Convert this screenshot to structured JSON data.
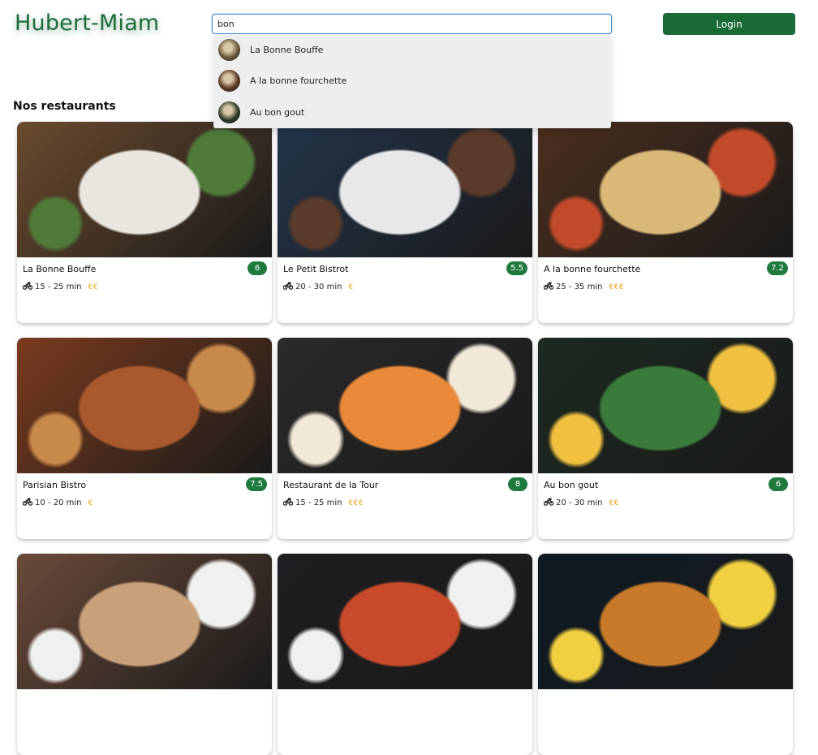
{
  "header": {
    "logo": "Hubert-Miam",
    "search_value": "bon",
    "login_label": "Login"
  },
  "flags": [
    "fr-flag-icon",
    "mx-flag-icon",
    "jp-flag-icon",
    "it-flag-icon"
  ],
  "search_results": [
    {
      "label": "La Bonne Bouffe",
      "thumb_color": "#6b5a3e"
    },
    {
      "label": "A la bonne fourchette",
      "thumb_color": "#5a3b26"
    },
    {
      "label": "Au bon gout",
      "thumb_color": "#2f3a2a"
    }
  ],
  "section_title": "Nos restaurants",
  "restaurants": [
    {
      "name": "La Bonne Bouffe",
      "rating": "6",
      "time": "15 - 25 min",
      "price": "€€",
      "colors": [
        "#6a4a2e",
        "#e9e6df",
        "#4f7a3a"
      ]
    },
    {
      "name": "Le Petit Bistrot",
      "rating": "5.5",
      "time": "20 - 30 min",
      "price": "€",
      "colors": [
        "#23344a",
        "#e8e8ea",
        "#5a3a2a"
      ]
    },
    {
      "name": "A la bonne fourchette",
      "rating": "7.2",
      "time": "25 - 35 min",
      "price": "€€€",
      "colors": [
        "#4a2e1e",
        "#d9b878",
        "#c14a2a"
      ]
    },
    {
      "name": "Parisian Bistro",
      "rating": "7.5",
      "time": "10 - 20 min",
      "price": "€",
      "colors": [
        "#7a3a1e",
        "#a85a2e",
        "#c88a4a"
      ]
    },
    {
      "name": "Restaurant de la Tour",
      "rating": "8",
      "time": "15 - 25 min",
      "price": "€€€",
      "colors": [
        "#2a2a2a",
        "#e88a3a",
        "#f0e8d8"
      ]
    },
    {
      "name": "Au bon gout",
      "rating": "6",
      "time": "20 - 30 min",
      "price": "€€",
      "colors": [
        "#1c2a20",
        "#3a7a3a",
        "#f0c040"
      ]
    },
    {
      "name": "",
      "rating": "",
      "time": "",
      "price": "",
      "colors": [
        "#6a4a3a",
        "#c8a07a",
        "#f0f0ee"
      ]
    },
    {
      "name": "",
      "rating": "",
      "time": "",
      "price": "",
      "colors": [
        "#1e1e22",
        "#c84a2a",
        "#f0f0f0"
      ]
    },
    {
      "name": "",
      "rating": "",
      "time": "",
      "price": "",
      "colors": [
        "#0e1a24",
        "#c87a2a",
        "#f0d040"
      ]
    }
  ],
  "theme": {
    "brand": "#1a6a38",
    "accent": "#4a90d9",
    "price": "#e9a51a"
  }
}
